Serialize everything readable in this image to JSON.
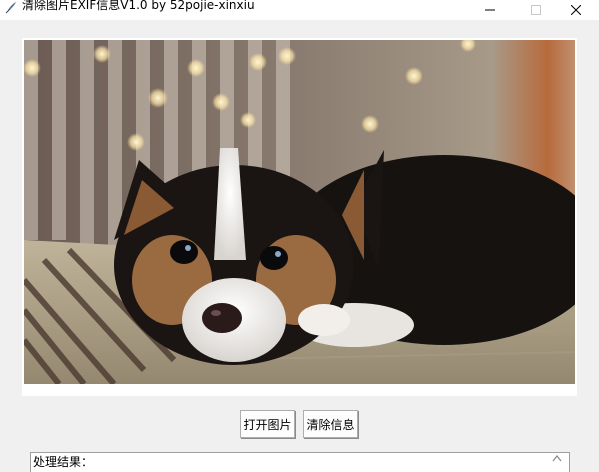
{
  "window": {
    "title": "清除图片EXIF信息V1.0 by 52pojie-xinxiu",
    "icon": "feather-icon",
    "controls": [
      "minimize-icon",
      "maximize-icon",
      "close-icon"
    ]
  },
  "image": {
    "subject": "corgi puppy photo",
    "icon": "puppy-photo"
  },
  "buttons": {
    "open_label": "打开图片",
    "clear_label": "清除信息"
  },
  "result": {
    "label": "处理结果："
  }
}
